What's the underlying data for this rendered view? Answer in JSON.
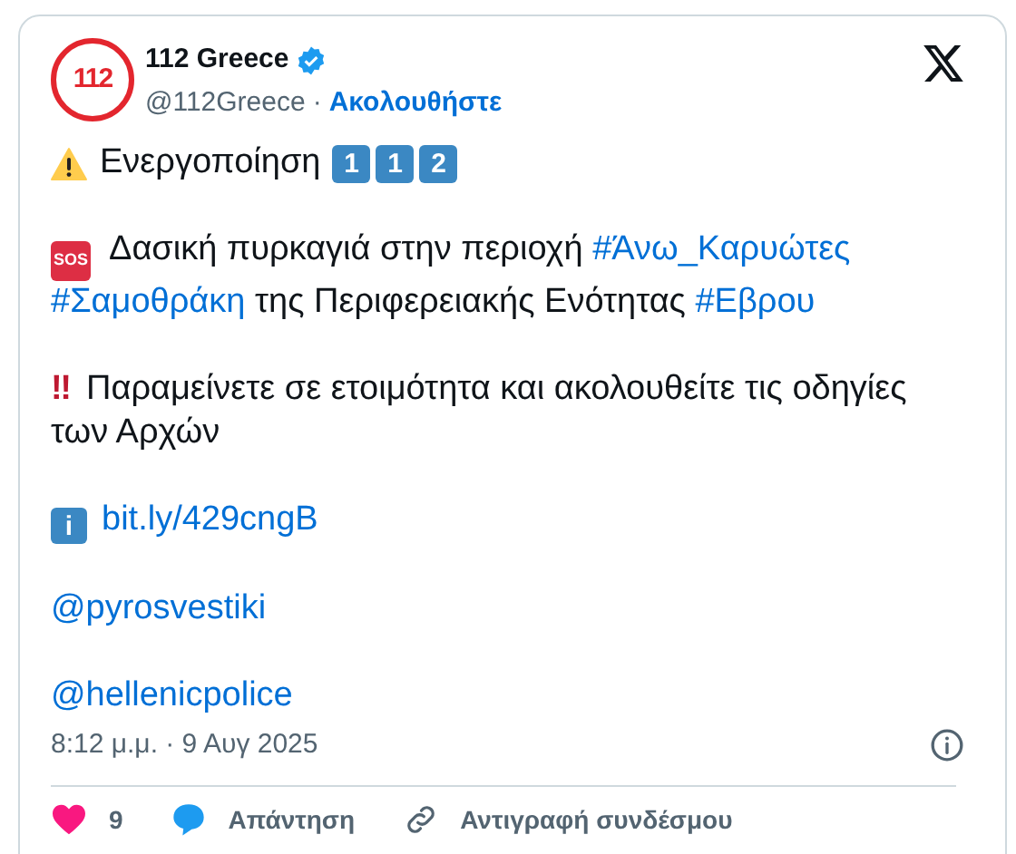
{
  "author": {
    "avatar_text": "112",
    "name": "112 Greece",
    "verified": true,
    "handle": "@112Greece",
    "separator": "·",
    "follow": "Ακολουθήστε"
  },
  "paragraphs": [
    {
      "kind": "activation",
      "text": "Ενεργοποίηση",
      "keycaps": [
        "1",
        "1",
        "2"
      ]
    },
    {
      "kind": "message",
      "badge": "SOS",
      "segments": [
        {
          "kind": "text",
          "text": "Δασική πυρκαγιά στην περιοχή "
        },
        {
          "kind": "link",
          "text": "#Άνω_Καρυώτες"
        },
        {
          "kind": "link",
          "text": "#Σαμοθράκη"
        },
        {
          "kind": "text",
          "text": " της Περιφερειακής Ενότητας "
        },
        {
          "kind": "link",
          "text": "#Εβρου"
        }
      ]
    },
    {
      "kind": "message",
      "mark": "‼",
      "segments": [
        {
          "kind": "text",
          "text": "Παραμείνετε σε ετοιμότητα και ακολουθείτε τις οδηγίες των Αρχών"
        }
      ]
    },
    {
      "kind": "message",
      "keycap": "i",
      "segments": [
        {
          "kind": "link",
          "text": "bit.ly/429cngB"
        }
      ]
    },
    {
      "kind": "message",
      "segments": [
        {
          "kind": "link",
          "text": "@pyrosvestiki"
        }
      ]
    },
    {
      "kind": "message",
      "segments": [
        {
          "kind": "link",
          "text": "@hellenicpolice"
        }
      ]
    }
  ],
  "timestamp": "8:12 μ.μ. · 9 Αυγ 2025",
  "actions": [
    {
      "kind": "like",
      "label": "9"
    },
    {
      "kind": "reply",
      "label": "Απάντηση"
    },
    {
      "kind": "copy",
      "label": "Αντιγραφή συνδέσμου"
    }
  ]
}
